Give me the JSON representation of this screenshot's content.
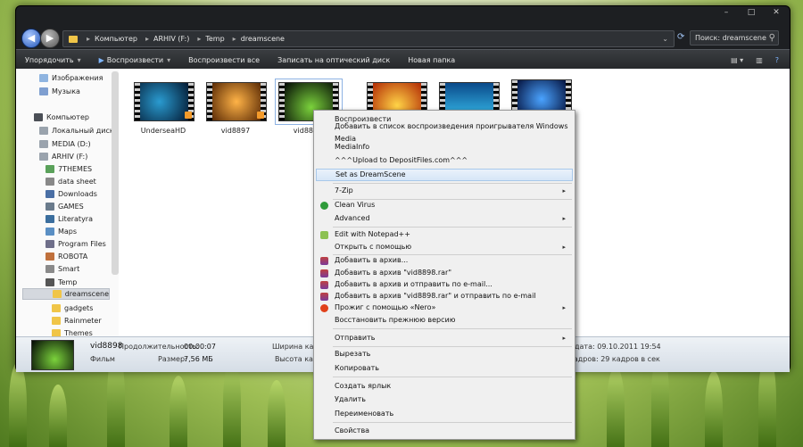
{
  "window": {
    "minimize": "–",
    "maximize": "□",
    "close": "✕"
  },
  "address": {
    "crumbs": [
      "Компьютер",
      "ARHIV (F:)",
      "Temp",
      "dreamscene"
    ],
    "separator": "▸"
  },
  "search": {
    "placeholder": "Поиск: dreamscene"
  },
  "toolbar": {
    "organize": "Упорядочить",
    "play": "Воспроизвести",
    "play_all": "Воспроизвести все",
    "burn": "Записать на оптический диск",
    "new_folder": "Новая папка"
  },
  "nav": {
    "items": [
      "Изображения",
      "Музыка",
      "Компьютер",
      "Локальный диск (C:)",
      "MEDIA (D:)",
      "ARHIV (F:)",
      "7THEMES",
      "data sheet",
      "Downloads",
      "GAMES",
      "Literatyra",
      "Maps",
      "Program Files",
      "ROBOTA",
      "Smart",
      "Temp",
      "dreamscene",
      "gadgets",
      "Rainmeter",
      "Themes"
    ]
  },
  "files": [
    {
      "name": "UnderseaHD",
      "color": "#0b3e6b"
    },
    {
      "name": "vid8897",
      "color": "#d9781a"
    },
    {
      "name": "vid8898",
      "color": "#0a1a12"
    },
    {
      "name": "",
      "color": "#e8541a"
    },
    {
      "name": "",
      "color": "#1a8fd6"
    },
    {
      "name": "",
      "color": "#123a9a"
    }
  ],
  "details": {
    "name": "vid8898",
    "type": "Фильм",
    "duration_label": "Продолжительность:",
    "duration": "00:00:07",
    "size_label": "Размер:",
    "size": "7,56 МБ",
    "width_label": "Ширина кадр",
    "height_label": "Высота кадр",
    "date_fragment": "дата: 09.10.2011 19:54",
    "fps_fragment": "кадров: 29 кадров в сек"
  },
  "context_menu": {
    "items": [
      "Воспроизвести",
      "Добавить в список воспроизведения проигрывателя Windows Media",
      "MediaInfo",
      "^^^Upload to DepositFiles.com^^^",
      "Set as DreamScene",
      "7-Zip",
      "Clean Virus",
      "Advanced",
      "Edit with Notepad++",
      "Открыть с помощью",
      "Добавить в архив...",
      "Добавить в архив \"vid8898.rar\"",
      "Добавить в архив и отправить по e-mail...",
      "Добавить в архив \"vid8898.rar\" и отправить по e-mail",
      "Прожиг с помощью «Nero»",
      "Восстановить прежнюю версию",
      "Отправить",
      "Вырезать",
      "Копировать",
      "Создать ярлык",
      "Удалить",
      "Переименовать",
      "Свойства"
    ],
    "submenu_arrow": "▸"
  }
}
